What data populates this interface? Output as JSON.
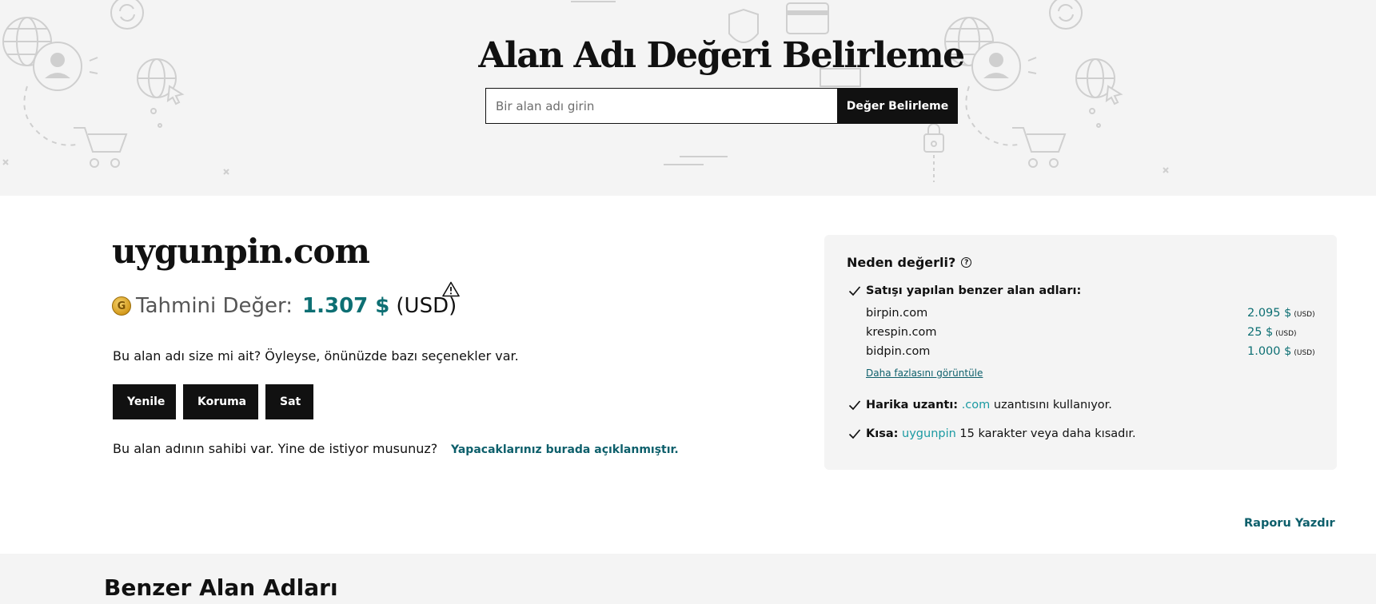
{
  "hero": {
    "title": "Alan Adı Değeri Belirleme",
    "search_placeholder": "Bir alan adı girin",
    "search_button": "Değer Belirleme"
  },
  "domain": {
    "name": "uygunpin.com",
    "value_label": "Tahmini Değer:",
    "value_amount": "1.307 $",
    "value_currency": "(USD)",
    "coin_icon": "coin-icon",
    "warning_icon": "warning-icon"
  },
  "ownership": {
    "question": "Bu alan adı size mi ait? Öyleyse, önünüzde bazı seçenekler var.",
    "actions": [
      "Yenile",
      "Koruma",
      "Sat"
    ],
    "owned_text": "Bu alan adının sahibi var. Yine de istiyor musunuz?",
    "owned_link": "Yapacaklarınız burada açıklanmıştır."
  },
  "panel": {
    "title": "Neden değerli?",
    "similar_heading": "Satışı yapılan benzer alan adları:",
    "similar": [
      {
        "name": "birpin.com",
        "price": "2.095 $",
        "currency": "(USD)"
      },
      {
        "name": "krespin.com",
        "price": "25 $",
        "currency": "(USD)"
      },
      {
        "name": "bidpin.com",
        "price": "1.000 $",
        "currency": "(USD)"
      }
    ],
    "more_link": "Daha fazlasını görüntüle",
    "extension_label": "Harika uzantı:",
    "extension_value": ".com",
    "extension_text": "uzantısını kullanıyor.",
    "short_label": "Kısa:",
    "short_value": "uygunpin",
    "short_text": "15 karakter veya daha kısadır."
  },
  "print_link": "Raporu Yazdır",
  "bottom": {
    "title": "Benzer Alan Adları"
  },
  "colors": {
    "accent_teal": "#0d6f73",
    "link_teal": "#0d5f6b",
    "highlight_teal": "#1b9aa2",
    "button_black": "#111111",
    "panel_bg": "#f4f4f4"
  }
}
